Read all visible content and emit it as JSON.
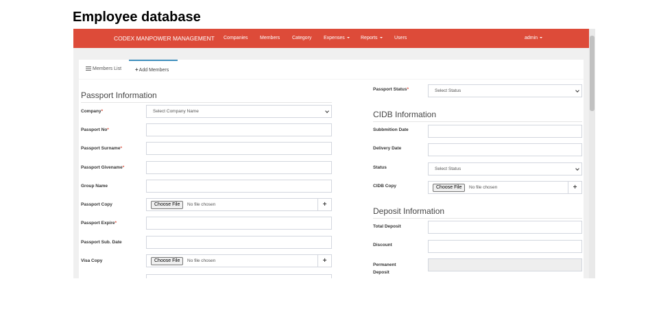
{
  "caption": "Employee database",
  "navbar": {
    "brand": "CODEX MANPOWER MANAGEMENT",
    "items": [
      "Companies",
      "Members",
      "Category",
      "Expenses",
      "Reports",
      "Users"
    ],
    "user": "admin",
    "color": "#dd4b39"
  },
  "tabs": {
    "list": "Members List",
    "add": "Add Members",
    "list_icon": "list-icon",
    "add_icon": "plus-icon"
  },
  "passport": {
    "title": "Passport Information",
    "company_label": "Company",
    "company_placeholder": "Select Company Name",
    "passport_no_label": "Passport No",
    "surname_label": "Passport Surname",
    "givenname_label": "Passport Givename",
    "group_label": "Group Name",
    "copy_label": "Passport Copy",
    "expire_label": "Passport Expire",
    "sub_date_label": "Passport Sub. Date",
    "visa_label": "Visa Copy"
  },
  "passport_status": {
    "label": "Passport Status",
    "placeholder": "Select Status"
  },
  "cidb": {
    "title": "CIDB Information",
    "submission_label": "Subbmition Date",
    "delivery_label": "Delivery Date",
    "status_label": "Status",
    "status_placeholder": "Select Status",
    "copy_label": "CIDB Copy"
  },
  "deposit": {
    "title": "Deposit Information",
    "total_label": "Total Deposit",
    "discount_label": "Discount",
    "permanent_label_1": "Permanent",
    "permanent_label_2": "Deposit"
  },
  "file": {
    "button": "Choose File",
    "status": "No file chosen",
    "add": "+"
  },
  "required_mark": "*"
}
